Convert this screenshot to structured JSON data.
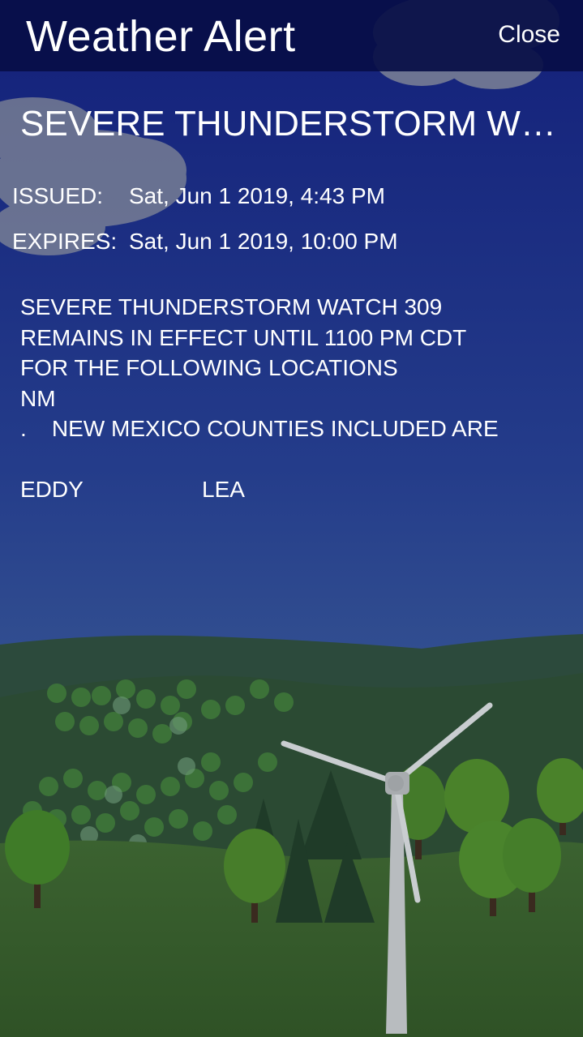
{
  "header": {
    "title": "Weather Alert",
    "close_label": "Close"
  },
  "alert": {
    "title": "SEVERE THUNDERSTORM W…",
    "issued_label": "ISSUED:",
    "issued_value": "Sat, Jun 1 2019, 4:43 PM",
    "expires_label": "EXPIRES:",
    "expires_value": "Sat, Jun 1 2019, 10:00 PM",
    "body_lines": [
      "SEVERE THUNDERSTORM WATCH 309",
      "REMAINS IN EFFECT UNTIL 1100 PM CDT",
      "FOR THE FOLLOWING LOCATIONS",
      "NM",
      ".    NEW MEXICO COUNTIES INCLUDED ARE"
    ],
    "counties": [
      "EDDY",
      "LEA"
    ]
  },
  "colors": {
    "sky_top": "#16237a",
    "sky_bottom": "#3a5b95",
    "hills_dark": "#2a4a38",
    "grass": "#3f6a2e",
    "tree": "#4f8a2c",
    "header_bg": "#0a1048"
  },
  "icons": {
    "background": "wind-turbine-landscape"
  }
}
